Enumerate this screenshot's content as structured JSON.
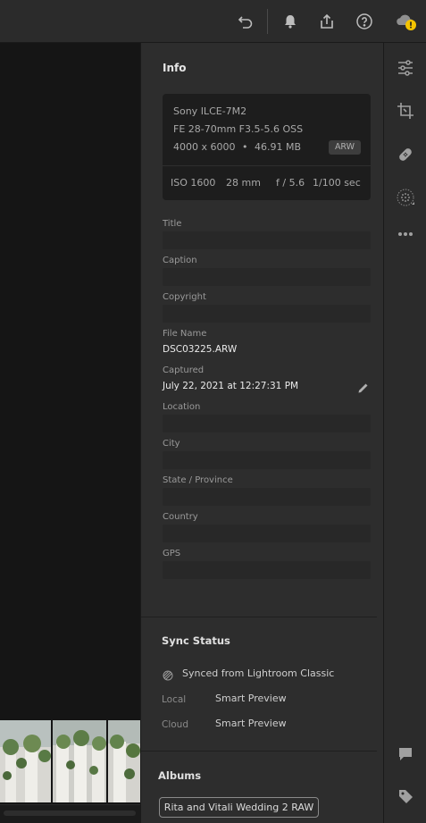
{
  "toolbar": {
    "undo_icon": "undo-icon",
    "notifications_icon": "bell-icon",
    "share_icon": "share-icon",
    "help_icon": "help-icon",
    "cloud_status_icon": "cloud-warning-icon",
    "warning_color": "#f5c400"
  },
  "info": {
    "heading": "Info",
    "camera": "Sony ILCE-7M2",
    "lens": "FE 28-70mm F3.5-5.6 OSS",
    "dimensions": "4000 x 6000",
    "dot": "•",
    "file_size": "46.91 MB",
    "format_badge": "ARW",
    "iso": "ISO 1600",
    "focal_length": "28 mm",
    "aperture": "f / 5.6",
    "shutter": "1/100 sec",
    "fields": {
      "title_label": "Title",
      "title_value": "",
      "caption_label": "Caption",
      "caption_value": "",
      "copyright_label": "Copyright",
      "copyright_value": "",
      "file_name_label": "File Name",
      "file_name_value": "DSC03225.ARW",
      "captured_label": "Captured",
      "captured_value": "July 22, 2021 at 12:27:31 PM",
      "location_label": "Location",
      "location_value": "",
      "city_label": "City",
      "city_value": "",
      "state_label": "State / Province",
      "state_value": "",
      "country_label": "Country",
      "country_value": "",
      "gps_label": "GPS",
      "gps_value": ""
    }
  },
  "sync": {
    "heading": "Sync Status",
    "status_text": "Synced from Lightroom Classic",
    "local_label": "Local",
    "local_value": "Smart Preview",
    "cloud_label": "Cloud",
    "cloud_value": "Smart Preview"
  },
  "albums": {
    "heading": "Albums",
    "items": [
      "Rita and Vitali Wedding 2 RAW"
    ]
  },
  "rail": {
    "icons": [
      "sliders-icon",
      "crop-icon",
      "healing-icon",
      "masking-icon",
      "more-icon",
      "comment-icon",
      "tag-icon"
    ]
  }
}
